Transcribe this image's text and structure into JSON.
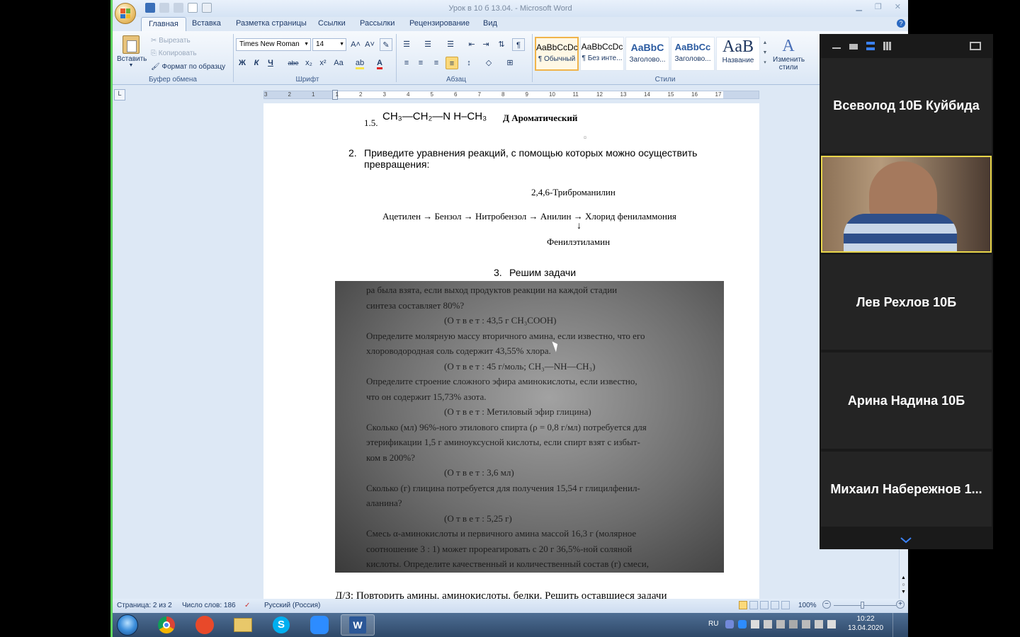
{
  "word": {
    "window_title": "Урок в 10 б 13.04. - Microsoft Word",
    "tabs": [
      "Главная",
      "Вставка",
      "Разметка страницы",
      "Ссылки",
      "Рассылки",
      "Рецензирование",
      "Вид"
    ],
    "clipboard": {
      "paste": "Вставить",
      "cut": "Вырезать",
      "copy": "Копировать",
      "format_painter": "Формат по образцу",
      "group": "Буфер обмена"
    },
    "font": {
      "name": "Times New Roman",
      "size": "14",
      "group": "Шрифт",
      "bold": "Ж",
      "italic": "К",
      "underline": "Ч",
      "strike": "abe",
      "subscript": "x₂",
      "superscript": "x²",
      "case": "Aa"
    },
    "paragraph": {
      "group": "Абзац"
    },
    "styles": {
      "group": "Стили",
      "items": [
        {
          "preview": "AaBbCcDc",
          "name": "¶ Обычный"
        },
        {
          "preview": "AaBbCcDc",
          "name": "¶ Без инте..."
        },
        {
          "preview": "AaBbC",
          "name": "Заголово..."
        },
        {
          "preview": "AaBbCc",
          "name": "Заголово..."
        },
        {
          "preview": "AaB",
          "name": "Название"
        }
      ],
      "change": "Изменить стили"
    },
    "ruler_numbers": [
      "3",
      "2",
      "1",
      "1",
      "2",
      "3",
      "4",
      "5",
      "6",
      "7",
      "8",
      "9",
      "10",
      "11",
      "12",
      "13",
      "14",
      "15",
      "16",
      "17"
    ],
    "document": {
      "item_1_5_number": "1.5.",
      "item_1_5_formula": "CH₃—CH₂—N H–CH₃",
      "item_1_5_answer": "Д Ароматический",
      "q2_number": "2.",
      "q2_text": "Приведите уравнения реакций, с помощью которых можно осуществить превращения:",
      "branch_top": "2,4,6-Триброманилин",
      "chain": "Ацетилен → Бензол → Нитробензол → Анилин → Хлорид фениламмония",
      "down_arrow": "↓",
      "branch_bottom": "Фенилэтиламин",
      "q3_number": "3.",
      "q3_text": "Решим задачи",
      "homework": "Д/З: Повторить  амины, аминокислоты, белки. Решить оставшиеся задачи"
    },
    "photo_text": {
      "lines": [
        "ра былa взята, если выход продуктов реакции на каждой стадии",
        "синтеза составляет 80%?",
        "(О т в е т : 43,5 г CH₃COOH)",
        "Определите молярную массу вторичного амина, если известно, что его",
        "хлороводородная соль содержит 43,55% хлора.",
        "(О т в е т : 45 г/моль; CH₃—NH—CH₃)",
        "Определите строение сложного эфира аминокислоты, если известно,",
        "что он содержит 15,73% азота.",
        "(О т в е т : Метиловый эфир глицина)",
        "Сколько (мл) 96%-ного этилового спирта (ρ = 0,8 г/мл) потребуется для",
        "этерификации 1,5 г аминоуксусной кислоты, если спирт взят с избыт-",
        "ком в 200%?",
        "(О т в е т : 3,6 мл)",
        "Сколько (г) глицина потребуется для получения 15,54 г глицилфенил-",
        "аланина?",
        "(О т в е т : 5,25 г)",
        "Смесь α-аминокислоты и первичного амина массой 16,3 г (молярное",
        "соотношение 3 : 1) может прореагировать с 20 г 36,5%-ной соляной",
        "кислоты. Определите качественный и количественный состав (г) смеси,"
      ]
    },
    "status": {
      "page": "Страница: 2 из 2",
      "words": "Число слов: 186",
      "language": "Русский (Россия)",
      "zoom": "100%",
      "zoom_minus": "−",
      "zoom_plus": "+"
    }
  },
  "taskbar": {
    "lang": "RU",
    "time": "10:22",
    "date": "13.04.2020"
  },
  "zoom": {
    "participants": [
      {
        "name": "Всеволод 10Б Куйбида"
      },
      {
        "name": ""
      },
      {
        "name": "Лев Рехлов 10Б"
      },
      {
        "name": "Арина Надина 10Б"
      },
      {
        "name": "Михаил Набережнов 1..."
      }
    ]
  },
  "colors": {
    "accent_green": "#5fd35f",
    "word_blue": "#dde8f5",
    "zoom_dark": "#1a1a1a",
    "active_speaker": "#e8d54a"
  }
}
